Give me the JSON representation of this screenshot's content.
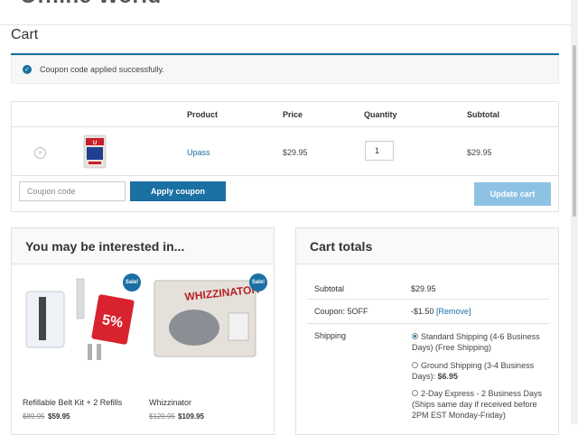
{
  "site": {
    "title": "Offline World"
  },
  "page": {
    "title": "Cart"
  },
  "notice": {
    "text": "Coupon code applied successfully."
  },
  "cart": {
    "headers": {
      "product": "Product",
      "price": "Price",
      "quantity": "Quantity",
      "subtotal": "Subtotal"
    },
    "items": [
      {
        "name": "Upass",
        "price": "$29.95",
        "quantity": "1",
        "subtotal": "$29.95"
      }
    ],
    "coupon_placeholder": "Coupon code",
    "apply_label": "Apply coupon",
    "update_label": "Update cart"
  },
  "crosssell": {
    "title": "You may be interested in...",
    "products": [
      {
        "name": "Refillable Belt Kit + 2 Refills",
        "old_price": "$89.95",
        "new_price": "$59.95",
        "badge": "Sale!"
      },
      {
        "name": "Whizzinator",
        "old_price": "$129.95",
        "new_price": "$109.95",
        "badge": "Sale!"
      }
    ]
  },
  "totals": {
    "title": "Cart totals",
    "subtotal_label": "Subtotal",
    "subtotal_value": "$29.95",
    "coupon_label": "Coupon: 5OFF",
    "coupon_value": "-$1.50",
    "coupon_remove": "[Remove]",
    "shipping_label": "Shipping",
    "shipping_options": [
      {
        "text": "Standard Shipping (4-6 Business Days) (Free Shipping)",
        "price": "",
        "selected": true
      },
      {
        "text": "Ground Shipping (3-4 Business Days):",
        "price": "$6.95",
        "selected": false
      },
      {
        "text": "2-Day Express - 2 Business Days (Ships same day if received before 2PM EST Monday-Friday)",
        "price": "",
        "selected": false
      }
    ]
  },
  "colors": {
    "accent": "#1a6fa3",
    "update_disabled": "#8ec2e3"
  }
}
